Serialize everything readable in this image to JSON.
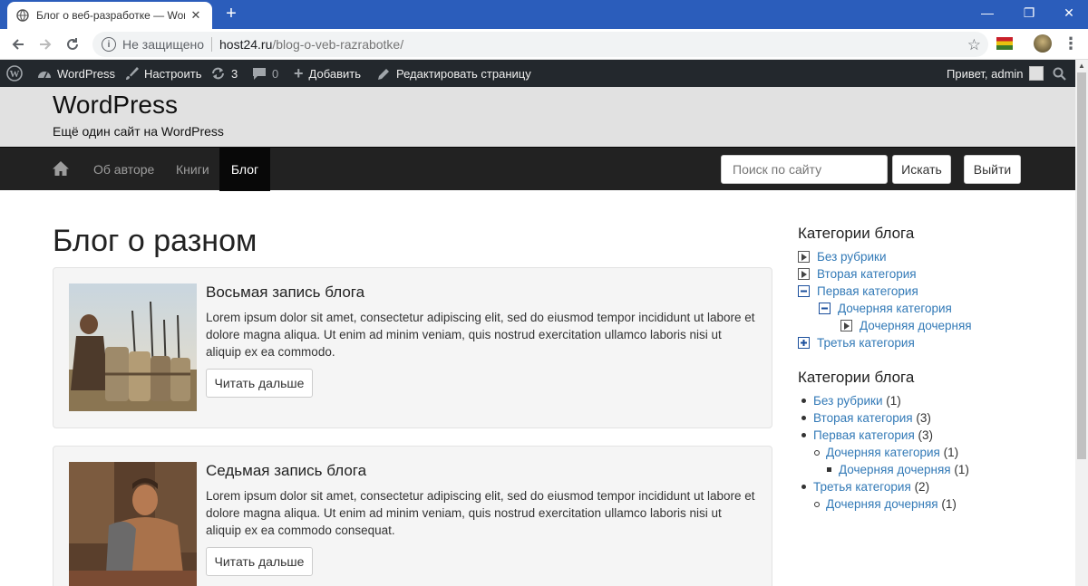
{
  "browser": {
    "tab_title": "Блог о веб-разработке — WordPress",
    "security_label": "Не защищено",
    "url_host": "host24.ru",
    "url_path": "/blog-o-veb-razrabotke/"
  },
  "admin_bar": {
    "site_name": "WordPress",
    "customize": "Настроить",
    "updates_count": "3",
    "comments_count": "0",
    "add_new": "Добавить",
    "edit_page": "Редактировать страницу",
    "greeting": "Привет, admin"
  },
  "site": {
    "title": "WordPress",
    "description": "Ещё один сайт на WordPress"
  },
  "nav": {
    "items": [
      {
        "label": "Об авторе"
      },
      {
        "label": "Книги"
      },
      {
        "label": "Блог"
      }
    ],
    "search_placeholder": "Поиск по сайту",
    "search_button": "Искать",
    "logout_button": "Выйти"
  },
  "main": {
    "heading": "Блог о разном",
    "posts": [
      {
        "title": "Восьмая запись блога",
        "excerpt": "Lorem ipsum dolor sit amet, consectetur adipiscing elit, sed do eiusmod tempor incididunt ut labore et dolore magna aliqua. Ut enim ad minim veniam, quis nostrud exercitation ullamco laboris nisi ut aliquip ex ea commodo.",
        "read_more": "Читать дальше"
      },
      {
        "title": "Седьмая запись блога",
        "excerpt": "Lorem ipsum dolor sit amet, consectetur adipiscing elit, sed do eiusmod tempor incididunt ut labore et dolore magna aliqua. Ut enim ad minim veniam, quis nostrud exercitation ullamco laboris nisi ut aliquip ex ea commodo consequat.",
        "read_more": "Читать дальше"
      }
    ]
  },
  "sidebar": {
    "tree_widget": {
      "title": "Категории блога",
      "items": [
        {
          "label": "Без рубрики",
          "state": "collapsed"
        },
        {
          "label": "Вторая категория",
          "state": "collapsed"
        },
        {
          "label": "Первая категория",
          "state": "expanded"
        },
        {
          "label": "Дочерняя категория",
          "state": "expanded"
        },
        {
          "label": "Дочерняя дочерняя",
          "state": "collapsed"
        },
        {
          "label": "Третья категория",
          "state": "expandable"
        }
      ]
    },
    "list_widget": {
      "title": "Категории блога",
      "items": [
        {
          "label": "Без рубрики",
          "count": "(1)"
        },
        {
          "label": "Вторая категория",
          "count": "(3)"
        },
        {
          "label": "Первая категория",
          "count": "(3)"
        },
        {
          "label": "Дочерняя категория",
          "count": "(1)"
        },
        {
          "label": "Дочерняя дочерняя",
          "count": "(1)"
        },
        {
          "label": "Третья категория",
          "count": "(2)"
        },
        {
          "label": "Дочерняя дочерняя",
          "count": "(1)"
        }
      ]
    }
  }
}
